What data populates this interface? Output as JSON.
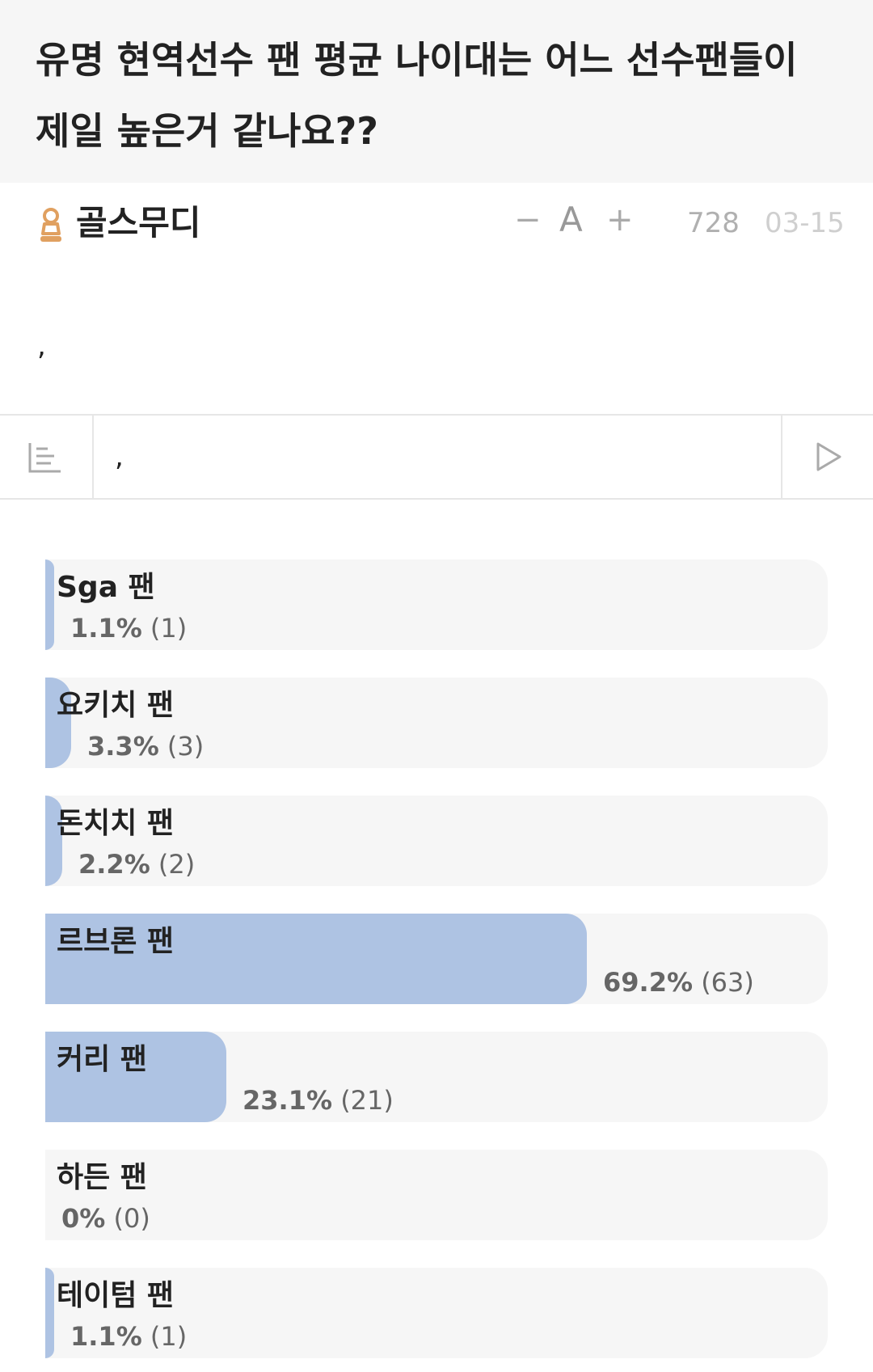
{
  "post": {
    "title_line1": "유명 현역선수 팬 평균 나이대는 어느 선수팬들이",
    "title_line2": "제일 높은거 같나요??",
    "author": "골스무디",
    "font_minus": "−",
    "font_a": "A",
    "font_plus": "+",
    "views": "728",
    "date": "03-15",
    "body": ","
  },
  "comment": {
    "value": ","
  },
  "icons": {
    "author": "user-badge-icon",
    "list": "comment-list-icon",
    "send": "send-icon"
  },
  "colors": {
    "fill": "#aec3e3",
    "track": "#f6f6f6",
    "author_icon": "#e0a060"
  },
  "poll": {
    "options": [
      {
        "label": "Sga 팬",
        "percent": 1.1,
        "percent_text": "1.1%",
        "count_text": "(1)"
      },
      {
        "label": "요키치 팬",
        "percent": 3.3,
        "percent_text": "3.3%",
        "count_text": "(3)"
      },
      {
        "label": "돈치치 팬",
        "percent": 2.2,
        "percent_text": "2.2%",
        "count_text": "(2)"
      },
      {
        "label": "르브론 팬",
        "percent": 69.2,
        "percent_text": "69.2%",
        "count_text": "(63)"
      },
      {
        "label": "커리 팬",
        "percent": 23.1,
        "percent_text": "23.1%",
        "count_text": "(21)"
      },
      {
        "label": "하든 팬",
        "percent": 0,
        "percent_text": "0%",
        "count_text": "(0)"
      },
      {
        "label": "테이텀 팬",
        "percent": 1.1,
        "percent_text": "1.1%",
        "count_text": "(1)"
      }
    ]
  }
}
